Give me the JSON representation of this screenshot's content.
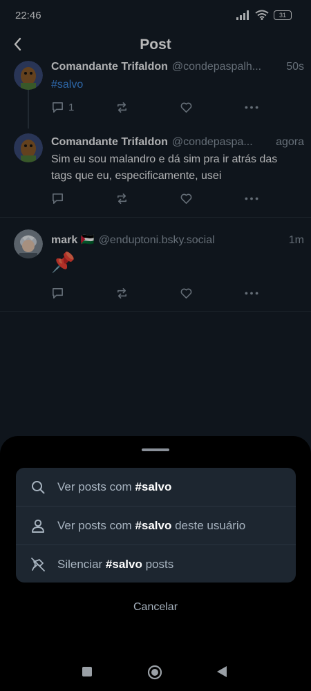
{
  "status_bar": {
    "time": "22:46",
    "battery": "31"
  },
  "header": {
    "title": "Post"
  },
  "posts": [
    {
      "author": "Comandante Trifaldon",
      "handle": "@condepaspalh...",
      "time": "50s",
      "text": "#salvo",
      "reply_count": "1"
    },
    {
      "author": "Comandante Trifaldon",
      "handle": "@condepaspa...",
      "time": "agora",
      "text": "Sim eu sou malandro e dá sim pra ir atrás das tags que eu, especificamente, usei"
    },
    {
      "author": "mark 🇵🇸",
      "handle": "@enduptoni.bsky.social",
      "time": "1m",
      "text": "📌"
    }
  ],
  "sheet": {
    "items": [
      {
        "prefix": "Ver posts com ",
        "tag": "#salvo",
        "suffix": "",
        "icon": "search-icon"
      },
      {
        "prefix": "Ver posts com ",
        "tag": "#salvo",
        "suffix": " deste usuário",
        "icon": "person-icon"
      },
      {
        "prefix": "Silenciar ",
        "tag": "#salvo",
        "suffix": " posts",
        "icon": "mute-icon"
      }
    ],
    "cancel": "Cancelar"
  },
  "colors": {
    "background": "#161e27",
    "hashtag": "#3f8ee8",
    "muted_text": "#8d99a6",
    "sheet": "#000000",
    "menu": "#1d2630"
  }
}
